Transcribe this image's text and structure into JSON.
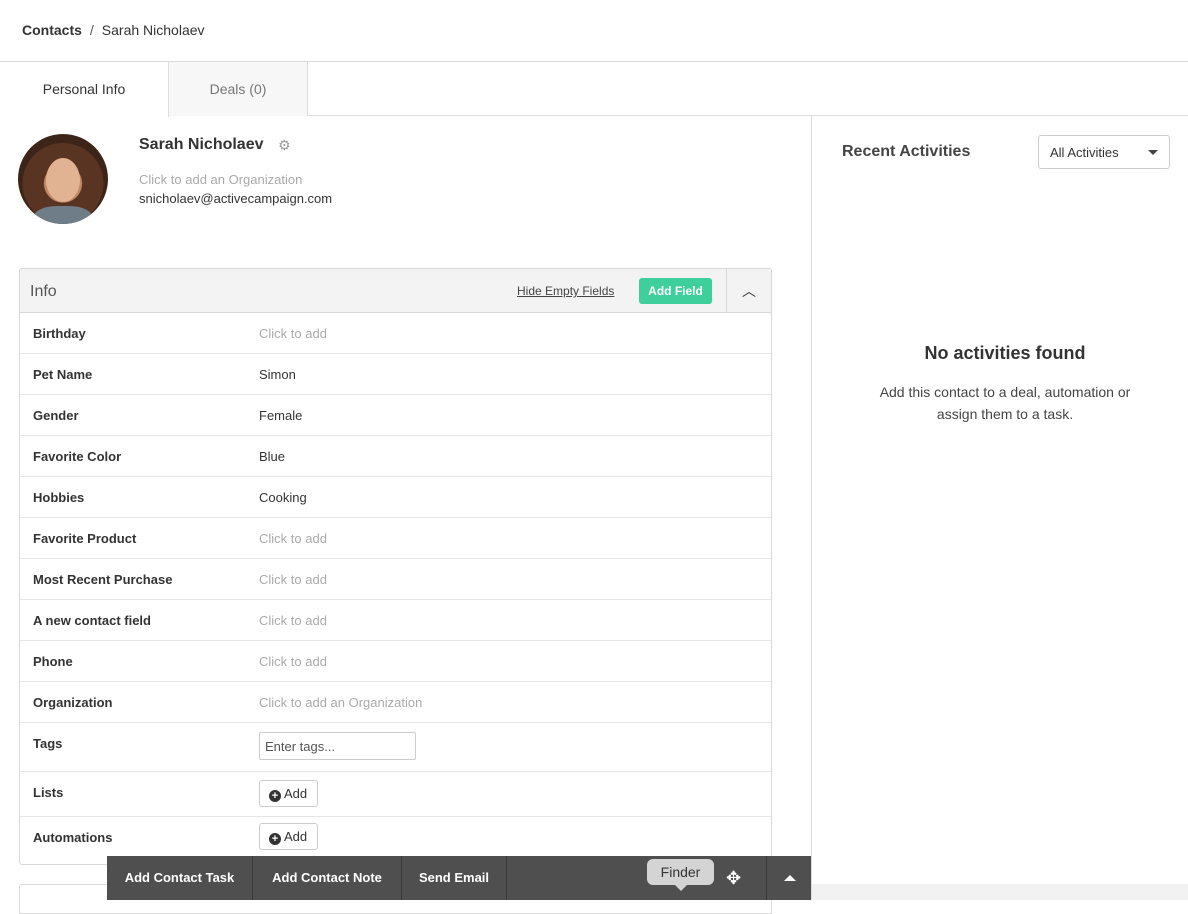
{
  "breadcrumb": {
    "root": "Contacts",
    "separator": "/",
    "current": "Sarah Nicholaev"
  },
  "tabs": [
    {
      "label": "Personal Info",
      "active": true
    },
    {
      "label": "Deals (0)",
      "active": false
    }
  ],
  "contact": {
    "name": "Sarah Nicholaev",
    "org_placeholder": "Click to add an Organization",
    "email": "snicholaev@activecampaign.com"
  },
  "info_panel": {
    "title": "Info",
    "hide_empty_label": "Hide Empty Fields",
    "add_field_label": "Add Field",
    "fields": [
      {
        "label": "Birthday",
        "value": "Click to add",
        "empty": true
      },
      {
        "label": "Pet Name",
        "value": "Simon",
        "empty": false
      },
      {
        "label": "Gender",
        "value": "Female",
        "empty": false
      },
      {
        "label": "Favorite Color",
        "value": "Blue",
        "empty": false
      },
      {
        "label": "Hobbies",
        "value": "Cooking",
        "empty": false
      },
      {
        "label": "Favorite Product",
        "value": "Click to add",
        "empty": true
      },
      {
        "label": "Most Recent Purchase",
        "value": "Click to add",
        "empty": true
      },
      {
        "label": "A new contact field",
        "value": "Click to add",
        "empty": true
      },
      {
        "label": "Phone",
        "value": "Click to add",
        "empty": true
      },
      {
        "label": "Organization",
        "value": "Click to add an Organization",
        "empty": true
      }
    ],
    "tags": {
      "label": "Tags",
      "placeholder": "Enter tags..."
    },
    "lists": {
      "label": "Lists",
      "add_label": "Add"
    },
    "automations": {
      "label": "Automations",
      "add_label": "Add"
    }
  },
  "activities": {
    "title": "Recent Activities",
    "filter_selected": "All Activities",
    "empty_title": "No activities found",
    "empty_desc": "Add this contact to a deal, automation or assign them to a task."
  },
  "action_bar": {
    "add_task": "Add Contact Task",
    "add_note": "Add Contact Note",
    "send_email": "Send Email",
    "finder_tooltip": "Finder"
  },
  "colors": {
    "accent_green": "#3fcf9d",
    "action_bar": "#4f4f4f"
  }
}
